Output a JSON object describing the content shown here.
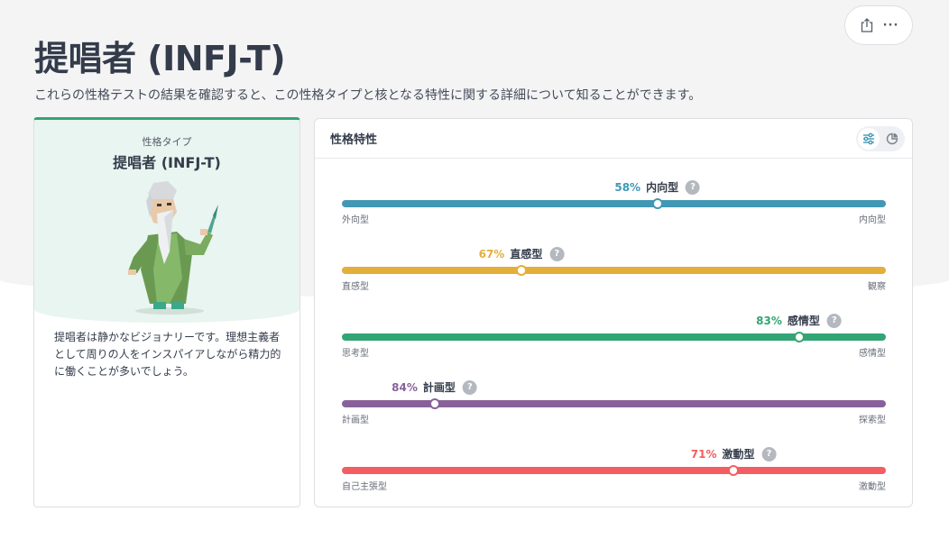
{
  "header": {
    "title": "提唱者 (INFJ-T)",
    "subtitle": "これらの性格テストの結果を確認すると、この性格タイプと核となる特性に関する詳細について知ることができます。"
  },
  "actions": {
    "share_icon": "share-icon",
    "more_label": "···"
  },
  "type_card": {
    "label": "性格タイプ",
    "name": "提唱者 (INFJ-T)",
    "description": "提唱者は静かなビジョナリーです。理想主義者として周りの人をインスパイアしながら精力的に働くことが多いでしょう。"
  },
  "traits_card": {
    "title": "性格特性",
    "view_icons": [
      "sliders-icon",
      "pie-chart-icon"
    ],
    "traits": [
      {
        "pct": 58,
        "pct_label": "58%",
        "name": "内向型",
        "left": "外向型",
        "right": "内向型",
        "position": 0.58,
        "color": "#4298b4",
        "help": "?"
      },
      {
        "pct": 67,
        "pct_label": "67%",
        "name": "直感型",
        "left": "直感型",
        "right": "観察",
        "position": 0.33,
        "color": "#e4ae3a",
        "help": "?"
      },
      {
        "pct": 83,
        "pct_label": "83%",
        "name": "感情型",
        "left": "思考型",
        "right": "感情型",
        "position": 0.84,
        "color": "#33a474",
        "help": "?"
      },
      {
        "pct": 84,
        "pct_label": "84%",
        "name": "計画型",
        "left": "計画型",
        "right": "探索型",
        "position": 0.17,
        "color": "#88619a",
        "help": "?"
      },
      {
        "pct": 71,
        "pct_label": "71%",
        "name": "激動型",
        "left": "自己主張型",
        "right": "激動型",
        "position": 0.72,
        "color": "#f25e62",
        "help": "?"
      }
    ]
  }
}
